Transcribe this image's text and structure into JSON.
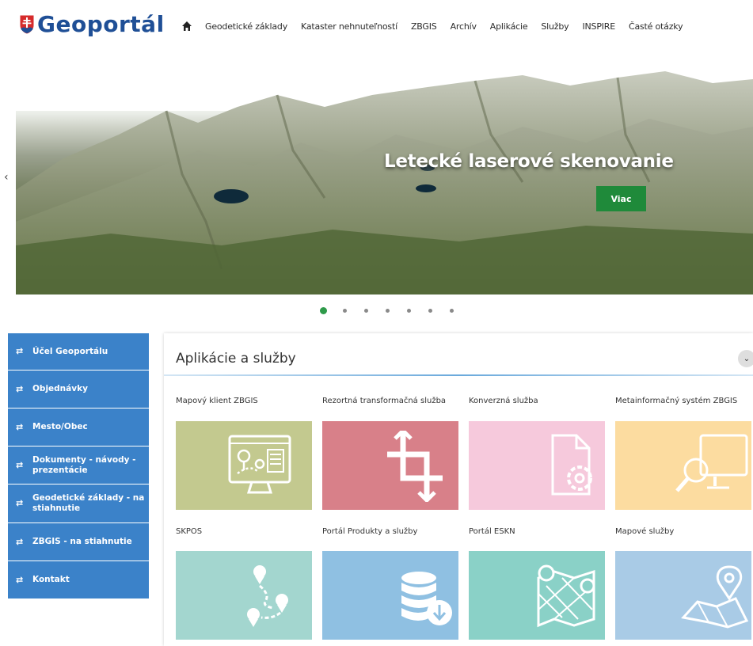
{
  "header": {
    "logo_text": "Geoportál",
    "nav": [
      "Geodetické základy",
      "Kataster nehnuteľností",
      "ZBGIS",
      "Archív",
      "Aplikácie",
      "Služby",
      "INSPIRE",
      "Časté otázky"
    ]
  },
  "hero": {
    "title": "Letecké laserové skenovanie",
    "button": "Viac",
    "prev_icon": "chevron-left",
    "slides_count": 7,
    "active_slide": 1
  },
  "sidebar": {
    "items": [
      {
        "label": "Účel Geoportálu",
        "icon": "link-icon"
      },
      {
        "label": "Objednávky",
        "icon": "link-icon"
      },
      {
        "label": "Mesto/Obec",
        "icon": "link-icon"
      },
      {
        "label": "Dokumenty - návody - prezentácie",
        "icon": "link-icon"
      },
      {
        "label": "Geodetické základy - na stiahnutie",
        "icon": "link-icon"
      },
      {
        "label": "ZBGIS - na stiahnutie",
        "icon": "link-icon"
      },
      {
        "label": "Kontakt",
        "icon": "link-icon"
      }
    ]
  },
  "panel": {
    "title": "Aplikácie a služby",
    "collapse_icon": "chevron-down",
    "tiles": [
      {
        "label": "Mapový klient ZBGIS",
        "color": "#c3c98f",
        "icon": "map-screen-icon"
      },
      {
        "label": "Rezortná transformačná služba",
        "color": "#d88089",
        "icon": "crop-transform-icon"
      },
      {
        "label": "Konverzná služba",
        "color": "#f6c9dc",
        "icon": "file-gear-icon"
      },
      {
        "label": "Metainformačný systém ZBGIS",
        "color": "#fcdca0",
        "icon": "search-monitor-icon"
      },
      {
        "label": "SKPOS",
        "color": "#a3d6cf",
        "icon": "route-pins-icon"
      },
      {
        "label": "Portál Produkty a služby",
        "color": "#8fc0e2",
        "icon": "database-download-icon"
      },
      {
        "label": "Portál ESKN",
        "color": "#8ad1c7",
        "icon": "map-pin-icon"
      },
      {
        "label": "Mapové služby",
        "color": "#a9cbe6",
        "icon": "map-location-icon"
      }
    ]
  }
}
